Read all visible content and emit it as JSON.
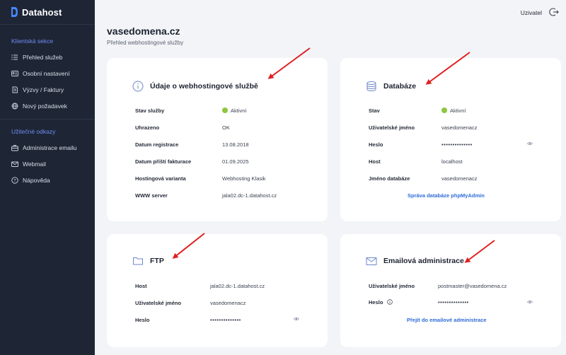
{
  "brand": {
    "name": "Datahost"
  },
  "sidebar": {
    "section1": "Klientská sekce",
    "items1": [
      {
        "label": "Přehled služeb",
        "icon": "list-icon"
      },
      {
        "label": "Osobní nastavení",
        "icon": "id-card-icon"
      },
      {
        "label": "Výzvy / Faktury",
        "icon": "document-icon"
      },
      {
        "label": "Nový požadavek",
        "icon": "globe-icon"
      }
    ],
    "section2": "Užitečné odkazy",
    "items2": [
      {
        "label": "Administrace emailu",
        "icon": "toolbox-icon"
      },
      {
        "label": "Webmail",
        "icon": "mail-icon"
      },
      {
        "label": "Nápověda",
        "icon": "help-icon"
      }
    ]
  },
  "header": {
    "user_label": "Uzivatel"
  },
  "page": {
    "title": "vasedomena.cz",
    "subtitle": "Přehled webhostingové služby"
  },
  "cards": {
    "hosting": {
      "title": "Údaje o webhostingové službě",
      "rows": [
        {
          "key": "Stav služby",
          "value": "Aktivní"
        },
        {
          "key": "Uhrazeno",
          "value": "OK"
        },
        {
          "key": "Datum registrace",
          "value": "13.08.2018"
        },
        {
          "key": "Datum příští fakturace",
          "value": "01.09.2025"
        },
        {
          "key": "Hostingová varianta",
          "value": "Webhosting Klasik"
        },
        {
          "key": "WWW server",
          "value": "jala02.dc-1.datahost.cz"
        }
      ]
    },
    "database": {
      "title": "Databáze",
      "rows": [
        {
          "key": "Stav",
          "value": "Aktivní"
        },
        {
          "key": "Uživatelské jméno",
          "value": "vasedomenacz"
        },
        {
          "key": "Heslo",
          "value": "••••••••••••••"
        },
        {
          "key": "Host",
          "value": "localhost"
        },
        {
          "key": "Jméno databáze",
          "value": "vasedomenacz"
        }
      ],
      "link": "Správa databáze phpMyAdmin"
    },
    "ftp": {
      "title": "FTP",
      "rows": [
        {
          "key": "Host",
          "value": "jala02.dc-1.datahost.cz"
        },
        {
          "key": "Uživatelské jméno",
          "value": "vasedomenacz"
        },
        {
          "key": "Heslo",
          "value": "••••••••••••••"
        }
      ]
    },
    "email": {
      "title": "Emailová administrace",
      "rows": [
        {
          "key": "Uživatelské jméno",
          "value": "postmaster@vasedomena.cz"
        },
        {
          "key": "Heslo",
          "value": "••••••••••••••"
        }
      ],
      "link": "Přejít do emailové administrace"
    }
  },
  "colors": {
    "sidebar_bg": "#1e2636",
    "accent_blue": "#2f6bd8",
    "status_green": "#8dc63f",
    "annotation_arrow": "#e02020"
  }
}
